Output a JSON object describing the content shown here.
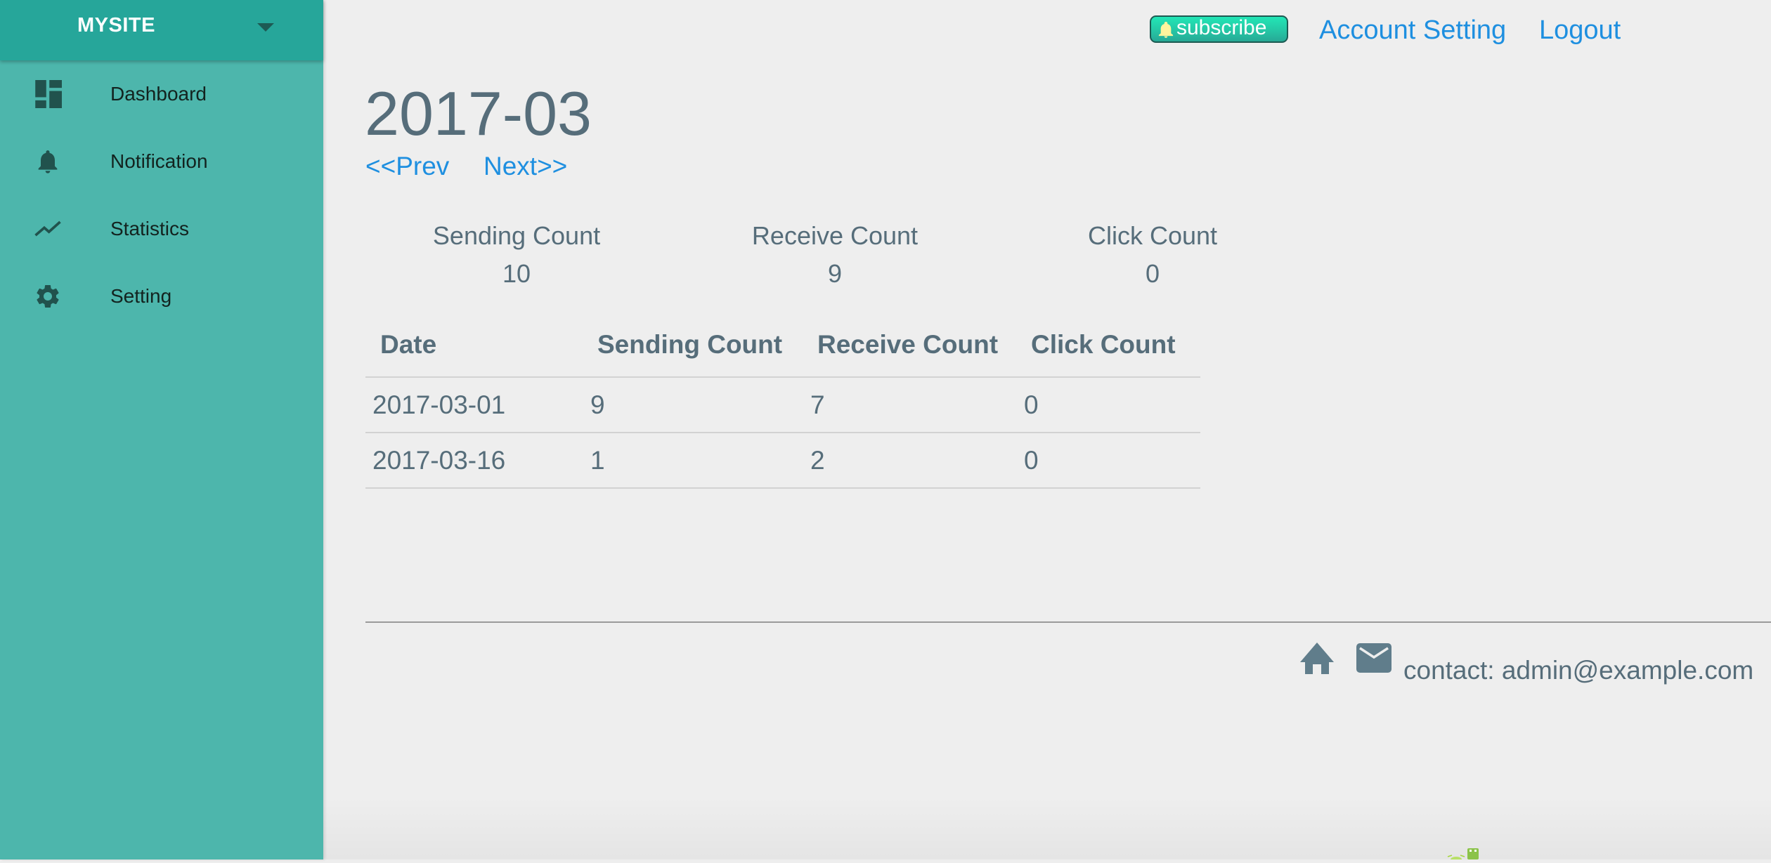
{
  "sidebar": {
    "brand": "MYSITE",
    "items": [
      {
        "label": "Dashboard",
        "icon": "dashboard-icon"
      },
      {
        "label": "Notification",
        "icon": "bell-icon"
      },
      {
        "label": "Statistics",
        "icon": "trending-icon"
      },
      {
        "label": "Setting",
        "icon": "gear-icon"
      }
    ]
  },
  "topbar": {
    "subscribe_label": "subscribe",
    "account_setting": "Account Setting",
    "logout": "Logout"
  },
  "main": {
    "month": "2017-03",
    "prev_label": "<<Prev",
    "next_label": "Next>>",
    "summary": [
      {
        "label": "Sending Count",
        "value": "10"
      },
      {
        "label": "Receive Count",
        "value": "9"
      },
      {
        "label": "Click Count",
        "value": "0"
      }
    ],
    "table": {
      "headers": [
        "Date",
        "Sending Count",
        "Receive Count",
        "Click Count"
      ],
      "rows": [
        [
          "2017-03-01",
          "9",
          "7",
          "0"
        ],
        [
          "2017-03-16",
          "1",
          "2",
          "0"
        ]
      ]
    }
  },
  "footer": {
    "contact": "contact: admin@example.com"
  },
  "colors": {
    "sidebar": "#4db6ac",
    "sidebar_header": "#26a69a",
    "link": "#1e8fe0",
    "text": "#566d7a"
  }
}
